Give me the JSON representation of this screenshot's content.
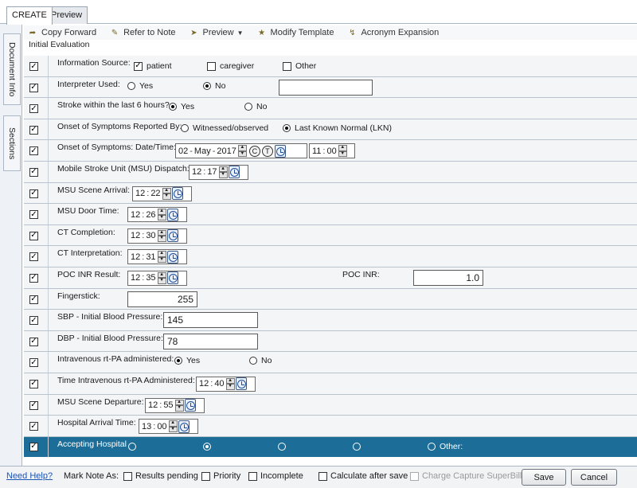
{
  "tabs": [
    {
      "label": "CREATE"
    },
    {
      "label": "Preview"
    }
  ],
  "side_tabs": [
    {
      "label": "Document Info"
    },
    {
      "label": "Sections"
    }
  ],
  "toolbar": {
    "copy_forward": "Copy Forward",
    "refer_to_note": "Refer to Note",
    "preview": "Preview",
    "modify_template": "Modify Template",
    "acronym_expansion": "Acronym Expansion"
  },
  "section_title": "Initial Evaluation",
  "form": {
    "info_source": {
      "label": "Information Source:",
      "opt1": "patient",
      "opt2": "caregiver",
      "opt3": "Other"
    },
    "interpreter": {
      "label": "Interpreter Used:",
      "yes": "Yes",
      "no": "No",
      "value": ""
    },
    "stroke6": {
      "label": "Stroke within the last 6 hours?",
      "yes": "Yes",
      "no": "No"
    },
    "onset_reported": {
      "label": "Onset of Symptoms Reported By:",
      "opt1": "Witnessed/observed",
      "opt2": "Last Known Normal (LKN)"
    },
    "onset_datetime": {
      "label": "Onset of Symptoms: Date/Time:",
      "day": "02",
      "month": "May",
      "year": "2017",
      "c_btn": "C",
      "t_btn": "T",
      "hour": "11",
      "min": "00"
    },
    "msu_dispatch": {
      "label": "Mobile Stroke Unit (MSU) Dispatch:",
      "hour": "12",
      "min": "17"
    },
    "msu_scene_arrival": {
      "label": "MSU Scene Arrival:",
      "hour": "12",
      "min": "22"
    },
    "msu_door_time": {
      "label": "MSU Door Time:",
      "hour": "12",
      "min": "26"
    },
    "ct_completion": {
      "label": "CT Completion:",
      "hour": "12",
      "min": "30"
    },
    "ct_interpretation": {
      "label": "CT Interpretation:",
      "hour": "12",
      "min": "31"
    },
    "poc_inr_result": {
      "label": "POC INR Result:",
      "hour": "12",
      "min": "35",
      "inr_label": "POC INR:",
      "inr_value": "1.0"
    },
    "fingerstick": {
      "label": "Fingerstick:",
      "value": "255"
    },
    "sbp": {
      "label": "SBP - Initial Blood Pressure:",
      "value": "145"
    },
    "dbp": {
      "label": "DBP - Initial Blood Pressure:",
      "value": "78"
    },
    "iv_tpa": {
      "label": "Intravenous rt-PA administered:",
      "yes": "Yes",
      "no": "No"
    },
    "time_iv_tpa": {
      "label": "Time Intravenous rt-PA Administered:",
      "hour": "12",
      "min": "40"
    },
    "msu_scene_departure": {
      "label": "MSU Scene Departure:",
      "hour": "12",
      "min": "55"
    },
    "hospital_arrival": {
      "label": "Hospital Arrival Time:",
      "hour": "13",
      "min": "00"
    },
    "accepting_hospital": {
      "label": "Accepting Hospital",
      "other": "Other:"
    }
  },
  "footer": {
    "need_help": "Need Help?",
    "mark_note_as": "Mark Note As:",
    "results_pending": "Results pending",
    "priority": "Priority",
    "incomplete": "Incomplete",
    "calc_after_save": "Calculate after save",
    "charge_capture": "Charge Capture SuperBill",
    "save": "Save",
    "cancel": "Cancel"
  },
  "colors": {
    "accent_row": "#1c6e99",
    "link": "#1a55b8"
  }
}
